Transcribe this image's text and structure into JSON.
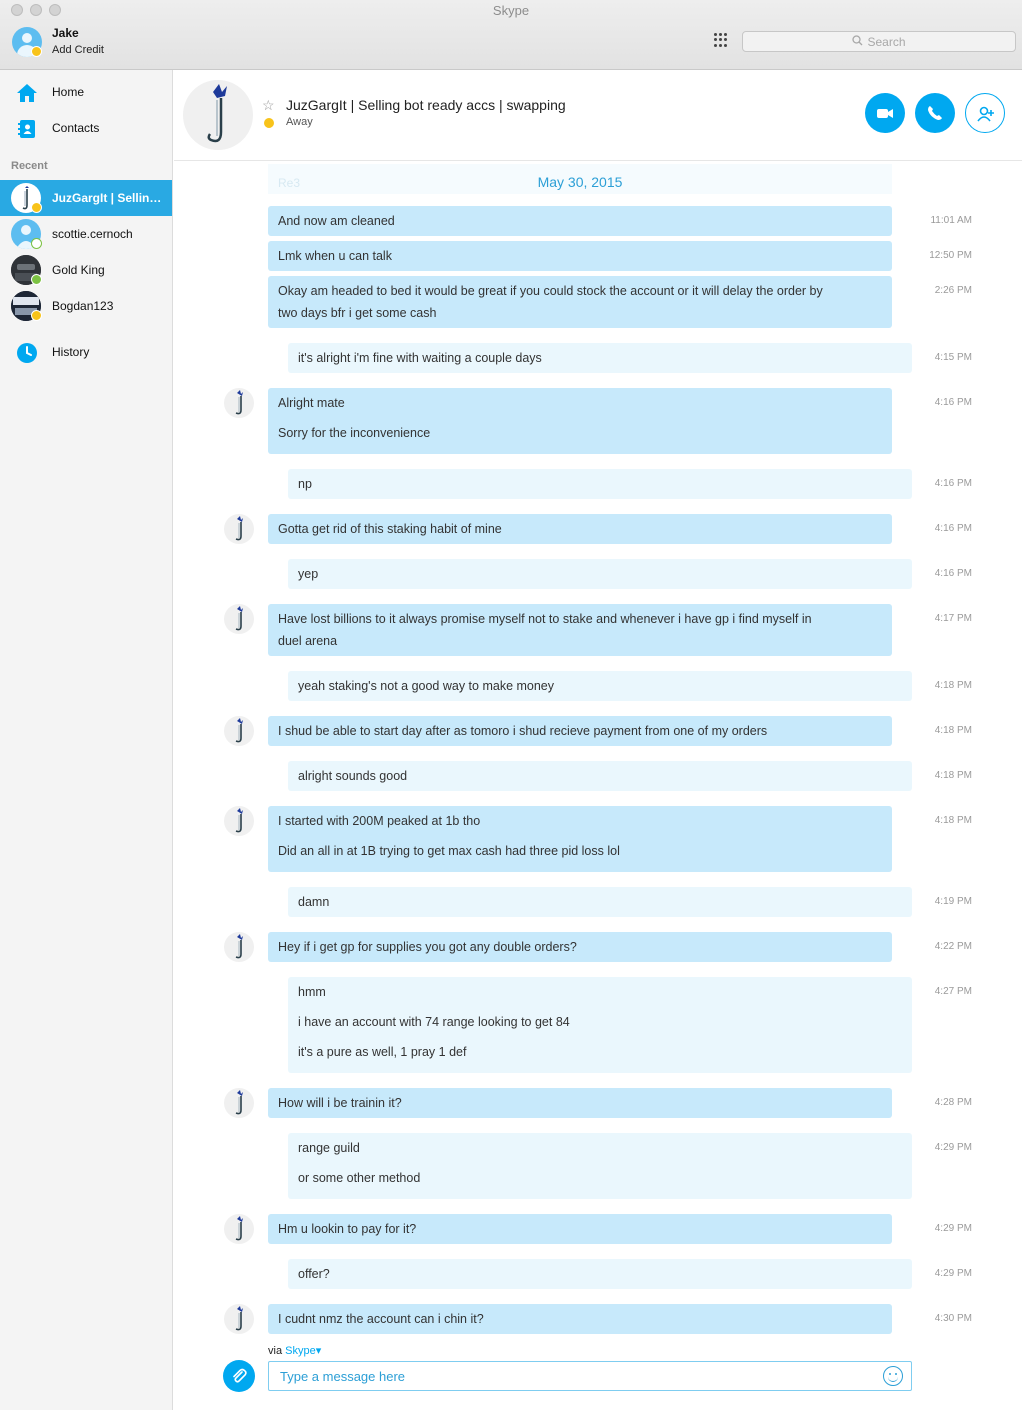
{
  "window": {
    "title": "Skype"
  },
  "account": {
    "name": "Jake",
    "subtitle": "Add Credit",
    "status": "away"
  },
  "search": {
    "placeholder": "Search"
  },
  "nav": {
    "home": "Home",
    "contacts": "Contacts",
    "recent_label": "Recent",
    "history": "History"
  },
  "recent": [
    {
      "name": "JuzGargIt | Selling bot ready accs | swapping",
      "status": "away",
      "active": true
    },
    {
      "name": "scottie.cernoch",
      "status": "offline",
      "active": false
    },
    {
      "name": "Gold King",
      "status": "online",
      "active": false
    },
    {
      "name": "Bogdan123",
      "status": "away",
      "active": false
    }
  ],
  "conversation": {
    "title": "JuzGargIt | Selling bot ready accs | swapping",
    "status": "Away",
    "date": "May 30, 2015",
    "ghost_text": "Re3"
  },
  "messages": [
    {
      "from": "them",
      "lines": [
        "And now am cleaned"
      ],
      "time": "11:01 AM"
    },
    {
      "from": "them",
      "lines": [
        "Lmk when u can talk"
      ],
      "time": "12:50 PM"
    },
    {
      "from": "them",
      "lines": [
        "Okay am headed to bed it would be great if you could stock the account or it will delay the order by",
        "two days bfr i get some cash"
      ],
      "time": "2:26 PM"
    },
    {
      "from": "me",
      "lines": [
        "it's alright i'm fine with waiting a couple days"
      ],
      "time": "4:15 PM"
    },
    {
      "from": "them",
      "lines": [
        "Alright mate",
        "Sorry for the inconvenience"
      ],
      "time": "4:16 PM"
    },
    {
      "from": "me",
      "lines": [
        "np"
      ],
      "time": "4:16 PM"
    },
    {
      "from": "them",
      "lines": [
        "Gotta get rid of this staking habit of mine"
      ],
      "time": "4:16 PM"
    },
    {
      "from": "me",
      "lines": [
        "yep"
      ],
      "time": "4:16 PM"
    },
    {
      "from": "them",
      "lines": [
        "Have lost billions to it always promise myself not to stake and whenever i have gp i find myself in",
        "duel arena"
      ],
      "time": "4:17 PM"
    },
    {
      "from": "me",
      "lines": [
        "yeah staking's not a good way to make money"
      ],
      "time": "4:18 PM"
    },
    {
      "from": "them",
      "lines": [
        "I shud be able to start day after as tomoro i shud recieve payment from one of my orders"
      ],
      "time": "4:18 PM"
    },
    {
      "from": "me",
      "lines": [
        "alright sounds good"
      ],
      "time": "4:18 PM"
    },
    {
      "from": "them",
      "lines": [
        "I started with 200M peaked at 1b tho",
        "Did an all in at 1B trying to get max cash had three pid loss lol"
      ],
      "time": "4:18 PM"
    },
    {
      "from": "me",
      "lines": [
        "damn"
      ],
      "time": "4:19 PM"
    },
    {
      "from": "them",
      "lines": [
        "Hey if i get gp for supplies you got any double orders?"
      ],
      "time": "4:22 PM"
    },
    {
      "from": "me",
      "lines": [
        "hmm",
        "i have an account with 74 range looking to get 84",
        "it's a pure as well, 1 pray 1 def"
      ],
      "time": "4:27 PM"
    },
    {
      "from": "them",
      "lines": [
        "How will i be trainin it?"
      ],
      "time": "4:28 PM"
    },
    {
      "from": "me",
      "lines": [
        "range guild",
        "or some other method"
      ],
      "time": "4:29 PM"
    },
    {
      "from": "them",
      "lines": [
        "Hm u lookin to pay for it?"
      ],
      "time": "4:29 PM"
    },
    {
      "from": "me",
      "lines": [
        "offer?"
      ],
      "time": "4:29 PM"
    },
    {
      "from": "them",
      "lines": [
        "I cudnt nmz the account can i chin it?"
      ],
      "time": "4:30 PM"
    }
  ],
  "composer": {
    "via_label": "via",
    "via_service": "Skype▾",
    "placeholder": "Type a message here"
  },
  "colors": {
    "accent": "#00a8f0",
    "their_bubble": "#c7e9fb",
    "my_bubble": "#eaf7fd",
    "away": "#f8c31a",
    "online": "#7cc243"
  },
  "icons": [
    "home-icon",
    "contacts-icon",
    "history-icon",
    "dialpad-icon",
    "search-icon",
    "video-call-icon",
    "phone-icon",
    "add-person-icon",
    "attach-icon",
    "emoji-icon",
    "star-icon"
  ]
}
